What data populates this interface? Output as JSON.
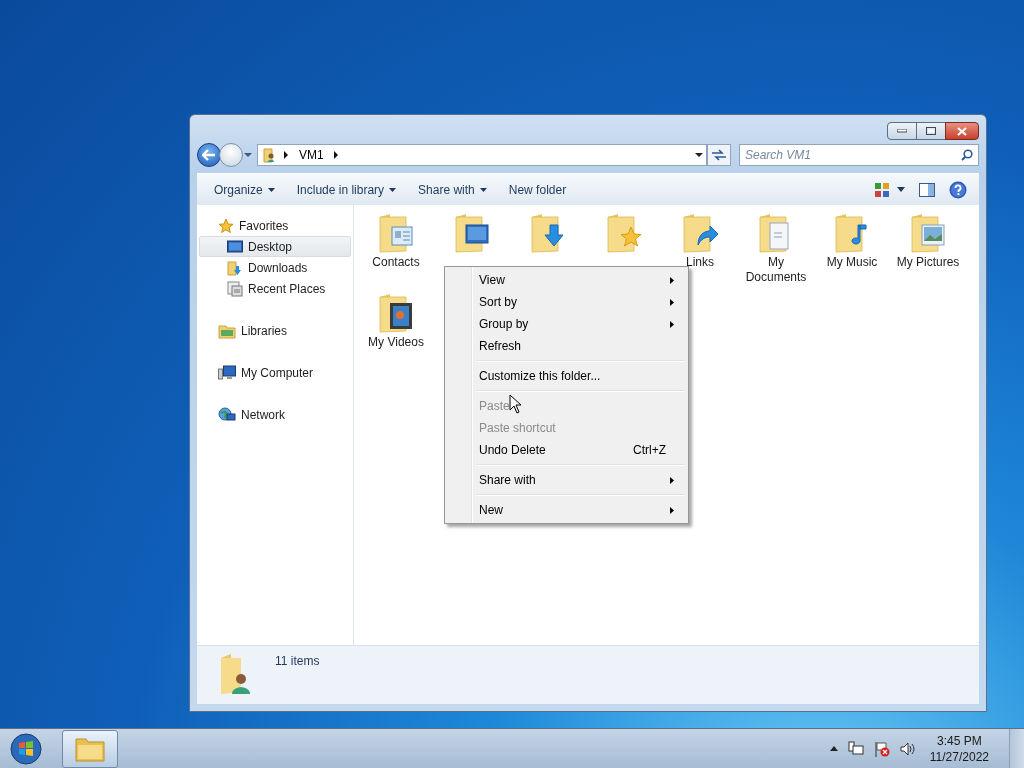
{
  "window": {
    "address": {
      "crumbs": [
        "VM1"
      ]
    },
    "search": {
      "placeholder": "Search VM1"
    },
    "toolbar": [
      {
        "label": "Organize",
        "dropdown": true
      },
      {
        "label": "Include in library",
        "dropdown": true
      },
      {
        "label": "Share with",
        "dropdown": true
      },
      {
        "label": "New folder",
        "dropdown": false
      }
    ],
    "sidebar": [
      {
        "label": "Favorites",
        "kind": "favorites",
        "selected": false,
        "children": [
          {
            "label": "Desktop",
            "kind": "desktop",
            "selected": true
          },
          {
            "label": "Downloads",
            "kind": "downloads",
            "selected": false
          },
          {
            "label": "Recent Places",
            "kind": "recent",
            "selected": false
          }
        ]
      },
      {
        "label": "Libraries",
        "kind": "libraries",
        "selected": false
      },
      {
        "label": "My Computer",
        "kind": "computer",
        "selected": false
      },
      {
        "label": "Network",
        "kind": "network",
        "selected": false
      }
    ],
    "items": [
      {
        "label": "Contacts",
        "kind": "contacts"
      },
      {
        "kind": "desktop"
      },
      {
        "kind": "downloads"
      },
      {
        "kind": "favorites"
      },
      {
        "label": "Links",
        "kind": "links"
      },
      {
        "label": "My Documents",
        "kind": "documents"
      },
      {
        "label": "My Music",
        "kind": "music"
      },
      {
        "label": "My Pictures",
        "kind": "pictures"
      },
      {
        "label": "My Videos",
        "kind": "videos"
      }
    ],
    "status": {
      "count": "11 items"
    }
  },
  "context_menu": {
    "groups": [
      [
        {
          "label": "View",
          "submenu": true,
          "disabled": false
        },
        {
          "label": "Sort by",
          "submenu": true,
          "disabled": false
        },
        {
          "label": "Group by",
          "submenu": true,
          "disabled": false
        },
        {
          "label": "Refresh",
          "submenu": false,
          "disabled": false
        }
      ],
      [
        {
          "label": "Customize this folder...",
          "submenu": false,
          "disabled": false
        }
      ],
      [
        {
          "label": "Paste",
          "submenu": false,
          "disabled": true
        },
        {
          "label": "Paste shortcut",
          "submenu": false,
          "disabled": true
        },
        {
          "label": "Undo Delete",
          "submenu": false,
          "disabled": false,
          "shortcut": "Ctrl+Z"
        }
      ],
      [
        {
          "label": "Share with",
          "submenu": true,
          "disabled": false
        }
      ],
      [
        {
          "label": "New",
          "submenu": true,
          "disabled": false
        }
      ]
    ]
  },
  "taskbar": {
    "time": "3:45 PM",
    "date": "11/27/2022"
  }
}
